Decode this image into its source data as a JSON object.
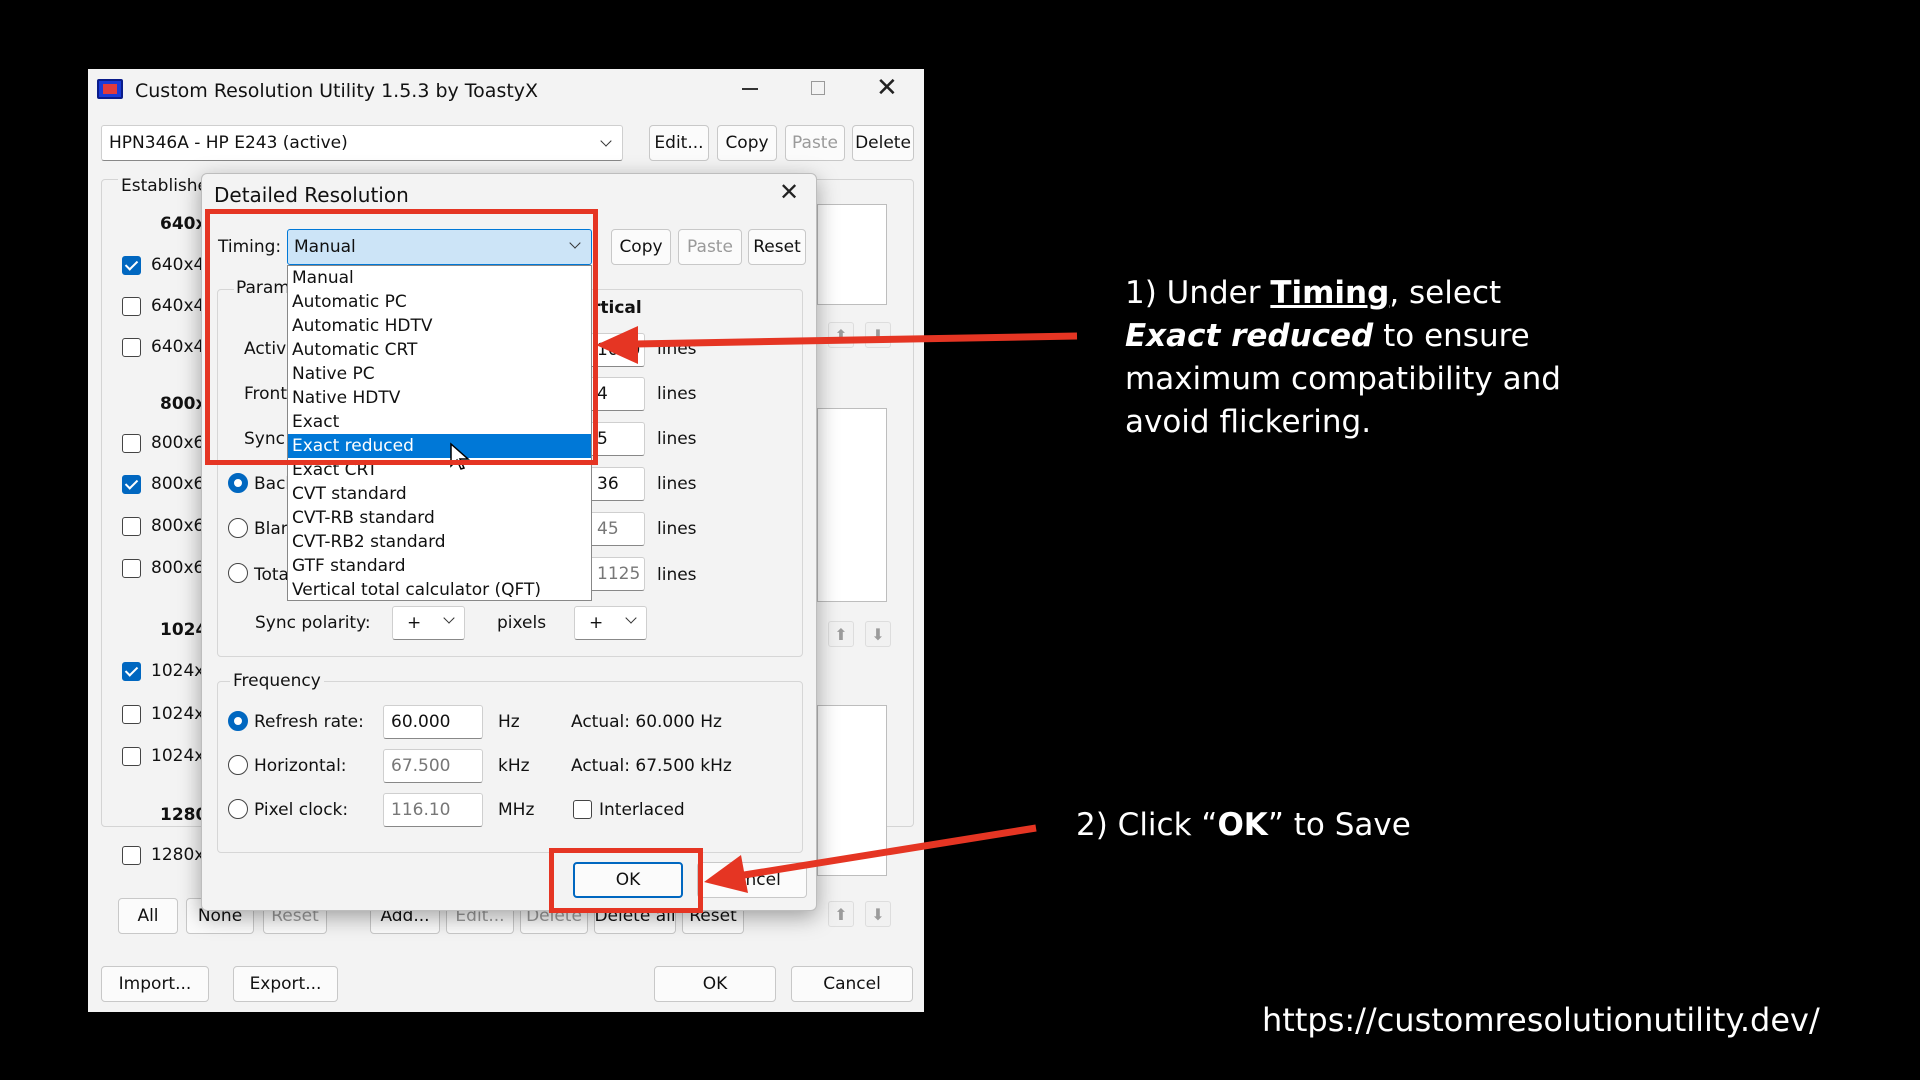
{
  "main_window": {
    "title": "Custom Resolution Utility 1.5.3 by ToastyX",
    "monitor_select": "HPN346A - HP E243 (active)",
    "buttons": {
      "edit": "Edit...",
      "copy": "Copy",
      "paste": "Paste",
      "delete": "Delete"
    },
    "established_label": "Established",
    "groups": [
      {
        "header": "640x",
        "items": [
          {
            "label": "640x4",
            "checked": true
          },
          {
            "label": "640x4",
            "checked": false
          },
          {
            "label": "640x4",
            "checked": false
          }
        ]
      },
      {
        "header": "800x",
        "items": [
          {
            "label": "800x6",
            "checked": false
          },
          {
            "label": "800x6",
            "checked": true
          },
          {
            "label": "800x6",
            "checked": false
          },
          {
            "label": "800x6",
            "checked": false
          }
        ]
      },
      {
        "header": "1024",
        "items": [
          {
            "label": "1024x",
            "checked": true
          },
          {
            "label": "1024x",
            "checked": false
          },
          {
            "label": "1024x",
            "checked": false
          }
        ]
      },
      {
        "header": "1280",
        "items": [
          {
            "label": "1280x",
            "checked": false
          }
        ]
      }
    ],
    "bottom_buttons": {
      "all": "All",
      "none": "None",
      "reset": "Reset",
      "add": "Add...",
      "edit": "Edit...",
      "delete": "Delete",
      "delete_all": "Delete all",
      "reset2": "Reset"
    },
    "footer_buttons": {
      "import": "Import...",
      "export": "Export...",
      "ok": "OK",
      "cancel": "Cancel"
    }
  },
  "dialog": {
    "title": "Detailed Resolution",
    "timing_label": "Timing:",
    "timing_value": "Manual",
    "buttons": {
      "copy": "Copy",
      "paste": "Paste",
      "reset": "Reset"
    },
    "parameters_label": "Parame",
    "vertical_label": "rtical",
    "rows": [
      {
        "label": "Active",
        "value": "1080",
        "unit": "lines"
      },
      {
        "label": "Front",
        "value": "4",
        "unit": "lines"
      },
      {
        "label": "Sync",
        "value": "5",
        "unit": "lines"
      },
      {
        "label": "Back",
        "value": "36",
        "unit": "lines"
      },
      {
        "label": "Blan",
        "value": "45",
        "unit": "lines"
      },
      {
        "label": "Tota",
        "value": "1125",
        "unit": "lines"
      }
    ],
    "sync_polarity_label": "Sync polarity:",
    "sync_polarity_h": "+",
    "pixels_label": "pixels",
    "sync_polarity_v": "+",
    "frequency": {
      "label": "Frequency",
      "refresh_label": "Refresh rate:",
      "refresh_value": "60.000",
      "refresh_unit": "Hz",
      "refresh_actual": "Actual: 60.000 Hz",
      "horizontal_label": "Horizontal:",
      "horizontal_value": "67.500",
      "horizontal_unit": "kHz",
      "horizontal_actual": "Actual: 67.500 kHz",
      "pixel_label": "Pixel clock:",
      "pixel_value": "116.10",
      "pixel_unit": "MHz",
      "interlaced_label": "Interlaced"
    },
    "ok": "OK",
    "cancel": "Cancel",
    "dropdown_options": [
      "Manual",
      "Automatic PC",
      "Automatic HDTV",
      "Automatic CRT",
      "Native PC",
      "Native HDTV",
      "Exact",
      "Exact reduced",
      "Exact CRT",
      "CVT standard",
      "CVT-RB standard",
      "CVT-RB2 standard",
      "GTF standard",
      "Vertical total calculator (QFT)"
    ],
    "dropdown_selected_index": 7
  },
  "annotations": {
    "step1_prefix": "1) Under ",
    "step1_timing": "Timing",
    "step1_mid": ", select",
    "step1_exact": "Exact reduced",
    "step1_rest": " to ensure",
    "step1_line3": "maximum compatibility and",
    "step1_line4": "avoid flickering.",
    "step2_prefix": "2) Click “",
    "step2_ok": "OK",
    "step2_suffix": "” to Save",
    "url": "https://customresolutionutility.dev/",
    "accent_color": "#e53523"
  }
}
